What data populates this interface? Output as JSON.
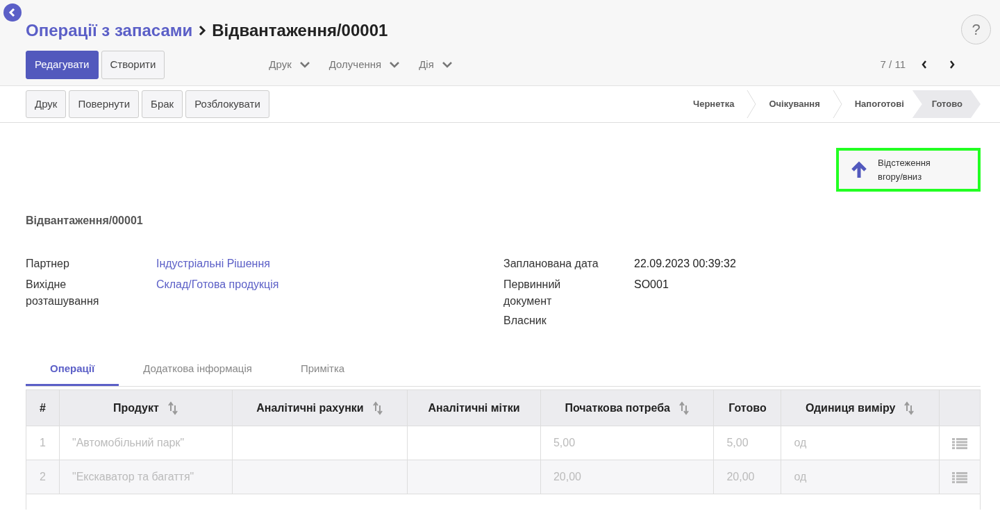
{
  "breadcrumb": {
    "parent": "Операції з запасами",
    "current": "Відвантаження/00001"
  },
  "help": "?",
  "main_buttons": [
    {
      "label": "Редагувати",
      "primary": true
    },
    {
      "label": "Створити",
      "primary": false
    }
  ],
  "dropdowns": [
    "Друк",
    "Долучення",
    "Дія"
  ],
  "pager": "7 / 11",
  "action_buttons": [
    "Друк",
    "Повернути",
    "Брак",
    "Розблокувати"
  ],
  "stages": [
    {
      "label": "Чернетка",
      "selected": false
    },
    {
      "label": "Очікування",
      "selected": false
    },
    {
      "label": "Напоготові",
      "selected": false
    },
    {
      "label": "Готово",
      "selected": true
    }
  ],
  "smart_button": {
    "label": "Відстеження вгору/вниз",
    "highlighted": true
  },
  "record_title": "Відвантаження/00001",
  "left_fields": [
    {
      "label": "Партнер",
      "value": "Індустріальні Рішення",
      "link": true
    },
    {
      "label": "Вихідне розташування",
      "value": "Склад/Готова продукція",
      "link": true
    }
  ],
  "right_fields": [
    {
      "label": "Запланована дата",
      "value": "22.09.2023 00:39:32"
    },
    {
      "label": "Первинний документ",
      "value": "SO001"
    },
    {
      "label": "Власник"
    }
  ],
  "tabs": [
    {
      "label": "Операції",
      "selected": true
    },
    {
      "label": "Додаткова інформація",
      "selected": false
    },
    {
      "label": "Примітка",
      "selected": false
    }
  ],
  "table": {
    "columns": [
      {
        "label": "#",
        "sortable": false
      },
      {
        "label": "Продукт",
        "sortable": true
      },
      {
        "label": "Аналітичні рахунки",
        "sortable": true
      },
      {
        "label": "Аналітичні мітки",
        "sortable": false
      },
      {
        "label": "Початкова потреба",
        "sortable": true
      },
      {
        "label": "Готово",
        "sortable": false
      },
      {
        "label": "Одиниця виміру",
        "sortable": true
      }
    ],
    "rows": [
      [
        "1",
        "\"Автомобільний парк\"",
        "",
        "",
        "5,00",
        "5,00",
        "од"
      ],
      [
        "2",
        "\"Екскаватор та багаття\"",
        "",
        "",
        "20,00",
        "20,00",
        "од"
      ]
    ]
  }
}
